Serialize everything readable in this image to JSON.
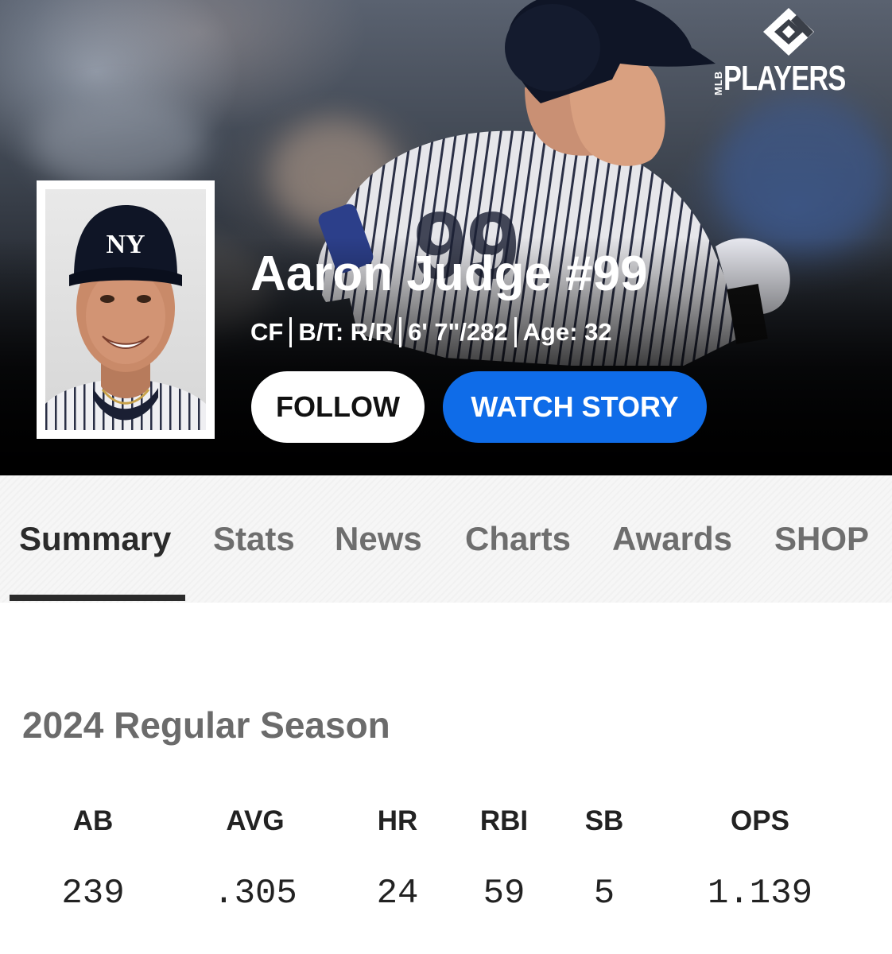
{
  "brand": {
    "logo_text": "PLAYERS",
    "logo_small_text": "MLB"
  },
  "player": {
    "name": "Aaron Judge #99",
    "position": "CF",
    "bats_throws": "B/T: R/R",
    "height_weight": "6' 7\"/282",
    "age": "Age: 32",
    "cap_logo": "NY"
  },
  "actions": {
    "follow_label": "FOLLOW",
    "watch_story_label": "WATCH STORY"
  },
  "tabs": [
    {
      "label": "Summary",
      "active": true
    },
    {
      "label": "Stats",
      "active": false
    },
    {
      "label": "News",
      "active": false
    },
    {
      "label": "Charts",
      "active": false
    },
    {
      "label": "Awards",
      "active": false
    },
    {
      "label": "SHOP",
      "active": false
    }
  ],
  "season": {
    "title": "2024 Regular Season",
    "stats": [
      {
        "label": "AB",
        "value": "239"
      },
      {
        "label": "AVG",
        "value": ".305"
      },
      {
        "label": "HR",
        "value": "24"
      },
      {
        "label": "RBI",
        "value": "59"
      },
      {
        "label": "SB",
        "value": "5"
      },
      {
        "label": "OPS",
        "value": "1.139"
      }
    ]
  },
  "colors": {
    "primary_button": "#0f6ce8",
    "active_tab": "#2b2b2b",
    "inactive_tab": "#6e6e6e"
  }
}
